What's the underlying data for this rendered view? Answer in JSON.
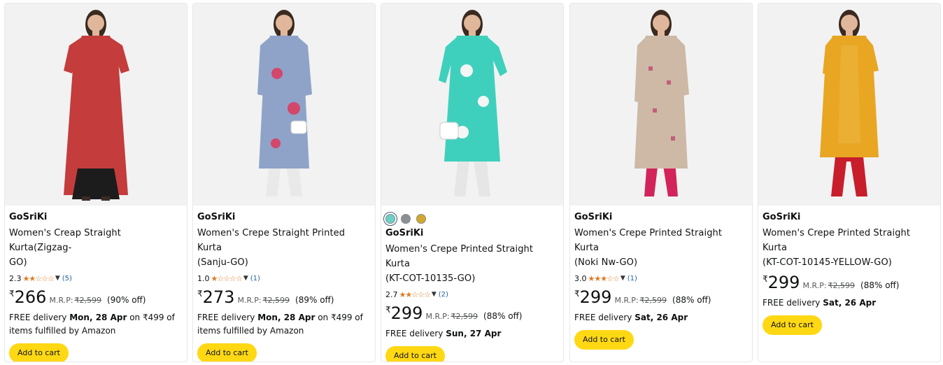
{
  "products": [
    {
      "brand": "GoSriKi",
      "title_line1": "Women's Creap Straight Kurta(Zigzag-",
      "title_line2": "GO)",
      "rating": "2.3",
      "stars": "★★☆☆☆",
      "reviews": "(5)",
      "currency": "₹",
      "price": "266",
      "mrp_label": "M.R.P:",
      "mrp": "₹2,599",
      "discount": "(90% off)",
      "delivery_prefix": "FREE delivery ",
      "delivery_date": "Mon, 28 Apr",
      "delivery_suffix": " on ₹499 of",
      "delivery_line2": "items fulfilled by Amazon",
      "add_to_cart": "Add to cart",
      "image_colors": {
        "dress": "#c43c3c",
        "accent": "#f2e9e4",
        "bottom": "#1c1c1c"
      }
    },
    {
      "brand": "GoSriKi",
      "title_line1": "Women's Crepe Straight Printed Kurta",
      "title_line2": "(Sanju-GO)",
      "rating": "1.0",
      "stars": "★☆☆☆☆",
      "reviews": "(1)",
      "currency": "₹",
      "price": "273",
      "mrp_label": "M.R.P:",
      "mrp": "₹2,599",
      "discount": "(89% off)",
      "delivery_prefix": "FREE delivery ",
      "delivery_date": "Mon, 28 Apr",
      "delivery_suffix": " on ₹499 of",
      "delivery_line2": "items fulfilled by Amazon",
      "add_to_cart": "Add to cart",
      "image_colors": {
        "dress": "#8fa3c9",
        "accent": "#d3476a",
        "bottom": "#e9e9e9"
      }
    },
    {
      "brand": "GoSriKi",
      "title_line1": "Women's Crepe Printed Straight Kurta",
      "title_line2": "(KT-COT-10135-GO)",
      "rating": "2.7",
      "stars": "★★☆☆☆",
      "reviews": "(2)",
      "currency": "₹",
      "price": "299",
      "mrp_label": "M.R.P:",
      "mrp": "₹2,599",
      "discount": "(88% off)",
      "delivery_prefix": "FREE delivery ",
      "delivery_date": "Sun, 27 Apr",
      "add_to_cart": "Add to cart",
      "swatches": [
        "#6ad1c6",
        "#8a8f96",
        "#d4a82c"
      ],
      "image_colors": {
        "dress": "#3fd0bd",
        "accent": "#f4f6f4",
        "bottom": "#e6e6e6"
      }
    },
    {
      "brand": "GoSriKi",
      "title_line1": "Women's Crepe Printed Straight Kurta",
      "title_line2": "(Noki Nw-GO)",
      "rating": "3.0",
      "stars": "★★★☆☆",
      "reviews": "(1)",
      "currency": "₹",
      "price": "299",
      "mrp_label": "M.R.P:",
      "mrp": "₹2,599",
      "discount": "(88% off)",
      "delivery_prefix": "FREE delivery ",
      "delivery_date": "Sat, 26 Apr",
      "add_to_cart": "Add to cart",
      "image_colors": {
        "dress": "#cdb9a6",
        "accent": "#c45d7a",
        "bottom": "#d2245a"
      }
    },
    {
      "brand": "GoSriKi",
      "title_line1": "Women's Crepe Printed Straight Kurta",
      "title_line2": "(KT-COT-10145-YELLOW-GO)",
      "currency": "₹",
      "price": "299",
      "mrp_label": "M.R.P:",
      "mrp": "₹2,599",
      "discount": "(88% off)",
      "delivery_prefix": "FREE delivery ",
      "delivery_date": "Sat, 26 Apr",
      "add_to_cart": "Add to cart",
      "image_colors": {
        "dress": "#e8a623",
        "accent": "#f0bd4a",
        "bottom": "#c81d2a"
      }
    }
  ],
  "colors": {
    "button": "#ffd814",
    "star": "#de7921",
    "link": "#2162a1",
    "muted": "#565959"
  },
  "icons": {
    "rating_caret": "chevron-down-icon"
  }
}
